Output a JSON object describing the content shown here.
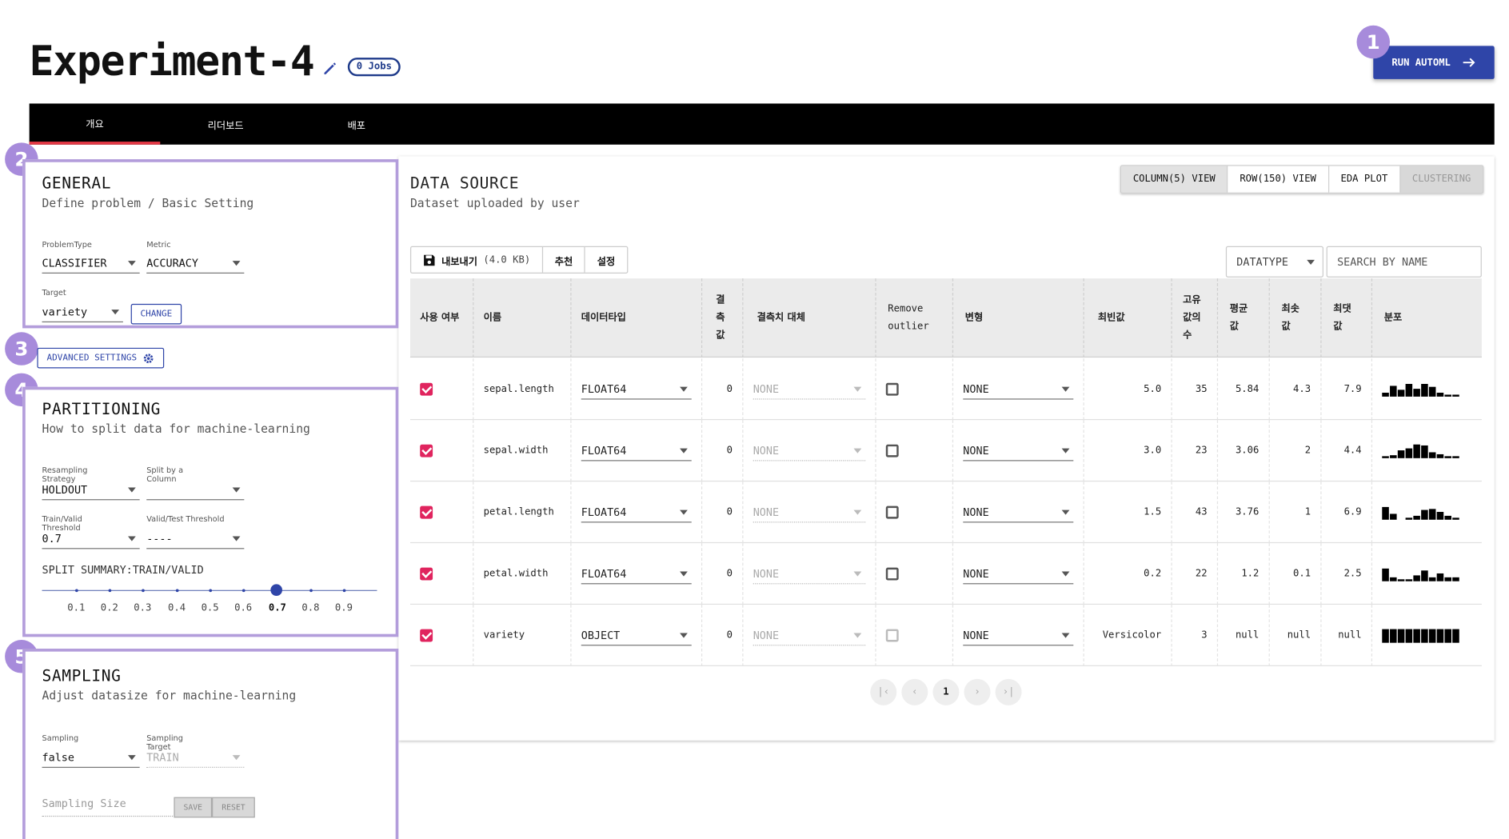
{
  "header": {
    "title": "Experiment-4",
    "jobs_badge": "0 Jobs",
    "run_button": "RUN AUTOML"
  },
  "markers": [
    "1",
    "2",
    "3",
    "4",
    "5"
  ],
  "tabs": [
    {
      "label": "개요",
      "active": true
    },
    {
      "label": "리더보드",
      "active": false
    },
    {
      "label": "배포",
      "active": false
    }
  ],
  "general": {
    "title": "GENERAL",
    "subtitle": "Define problem / Basic Setting",
    "problem_type_label": "ProblemType",
    "problem_type_value": "CLASSIFIER",
    "metric_label": "Metric",
    "metric_value": "ACCURACY",
    "target_label": "Target",
    "target_value": "variety",
    "change_button": "CHANGE"
  },
  "advanced": {
    "button": "ADVANCED SETTINGS"
  },
  "partitioning": {
    "title": "PARTITIONING",
    "subtitle": "How to split data for machine-learning",
    "resampling_label": "Resampling Strategy",
    "resampling_value": "HOLDOUT",
    "split_by_label": "Split by a Column",
    "split_by_value": "",
    "train_valid_label": "Train/Valid Threshold",
    "train_valid_value": "0.7",
    "valid_test_label": "Valid/Test Threshold",
    "valid_test_value": "----",
    "summary_label": "SPLIT SUMMARY:TRAIN/VALID",
    "slider_value": 0.7,
    "ticks": [
      "0.1",
      "0.2",
      "0.3",
      "0.4",
      "0.5",
      "0.6",
      "0.7",
      "0.8",
      "0.9"
    ]
  },
  "sampling": {
    "title": "SAMPLING",
    "subtitle": "Adjust datasize for machine-learning",
    "sampling_label": "Sampling",
    "sampling_value": "false",
    "target_label": "Sampling Target",
    "target_value": "TRAIN",
    "size_placeholder": "Sampling Size",
    "save_button": "SAVE",
    "reset_button": "RESET"
  },
  "data_source": {
    "title": "DATA SOURCE",
    "subtitle": "Dataset uploaded by user",
    "views": [
      {
        "label": "COLUMN(5) VIEW",
        "state": "active"
      },
      {
        "label": "ROW(150) VIEW",
        "state": "normal"
      },
      {
        "label": "EDA PLOT",
        "state": "normal"
      },
      {
        "label": "CLUSTERING",
        "state": "disabled"
      }
    ],
    "export_label": "내보내기",
    "export_size": "(4.0 KB)",
    "recommend_label": "추천",
    "settings_label": "설정",
    "datatype_filter": "DATATYPE",
    "search_placeholder": "SEARCH BY NAME",
    "headers": {
      "use": "사용 여부",
      "name": "이름",
      "dtype": "데이터타입",
      "missing": "결측값",
      "impute": "결측치 대체",
      "outlier": "Remove outlier",
      "transform": "변형",
      "mode": "최빈값",
      "unique": "고유값의 수",
      "mean": "평균값",
      "min": "최솟값",
      "max": "최댓값",
      "dist": "분포"
    },
    "rows": [
      {
        "name": "sepal.length",
        "dtype": "FLOAT64",
        "missing": "0",
        "impute": "NONE",
        "transform": "NONE",
        "mode": "5.0",
        "unique": "35",
        "mean": "5.84",
        "min": "4.3",
        "max": "7.9",
        "hist": [
          0.3,
          0.8,
          0.5,
          0.9,
          0.6,
          0.9,
          0.7,
          0.3,
          0.15,
          0.15
        ]
      },
      {
        "name": "sepal.width",
        "dtype": "FLOAT64",
        "missing": "0",
        "impute": "NONE",
        "transform": "NONE",
        "mode": "3.0",
        "unique": "23",
        "mean": "3.06",
        "min": "2",
        "max": "4.4",
        "hist": [
          0.1,
          0.2,
          0.6,
          0.7,
          1.0,
          0.9,
          0.4,
          0.3,
          0.1,
          0.1
        ]
      },
      {
        "name": "petal.length",
        "dtype": "FLOAT64",
        "missing": "0",
        "impute": "NONE",
        "transform": "NONE",
        "mode": "1.5",
        "unique": "43",
        "mean": "3.76",
        "min": "1",
        "max": "6.9",
        "hist": [
          0.9,
          0.4,
          0,
          0.1,
          0.3,
          0.7,
          0.8,
          0.6,
          0.3,
          0.1
        ]
      },
      {
        "name": "petal.width",
        "dtype": "FLOAT64",
        "missing": "0",
        "impute": "NONE",
        "transform": "NONE",
        "mode": "0.2",
        "unique": "22",
        "mean": "1.2",
        "min": "0.1",
        "max": "2.5",
        "hist": [
          0.9,
          0.3,
          0.05,
          0.05,
          0.4,
          0.8,
          0.3,
          0.6,
          0.3,
          0.3
        ]
      },
      {
        "name": "variety",
        "dtype": "OBJECT",
        "missing": "0",
        "impute": "NONE",
        "transform": "NONE",
        "mode": "Versicolor",
        "unique": "3",
        "mean": "null",
        "min": "null",
        "max": "null",
        "hist": [
          1,
          1,
          1,
          1,
          1,
          1,
          1,
          1,
          1,
          1
        ],
        "outlier_disabled": true
      }
    ],
    "pagination": {
      "current": "1"
    }
  }
}
